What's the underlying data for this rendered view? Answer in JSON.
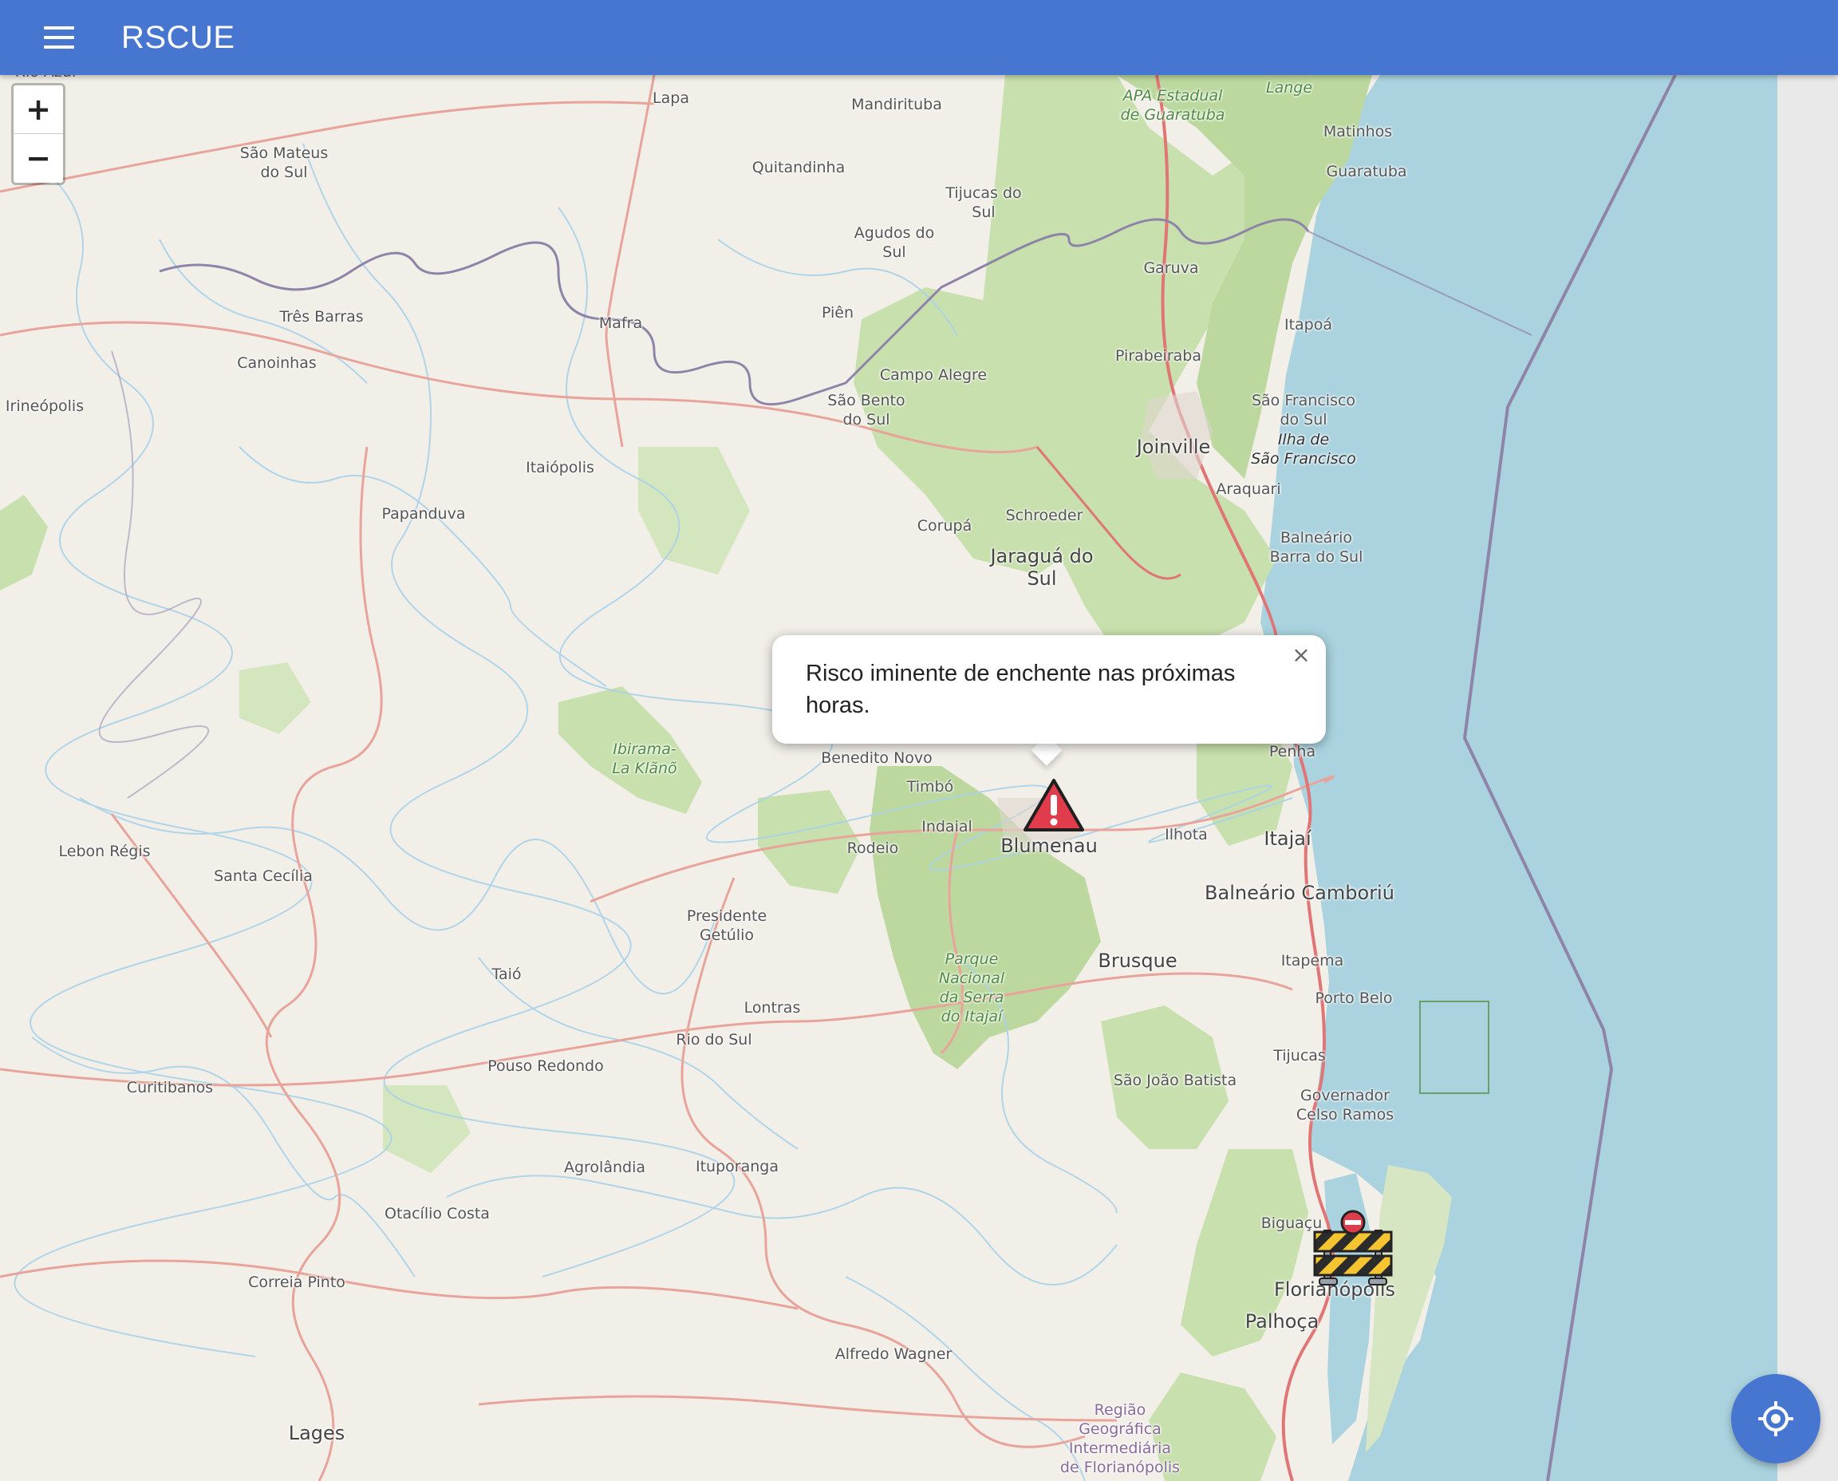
{
  "app": {
    "title": "RSCUE"
  },
  "toolbar": {
    "menu_icon": "hamburger-menu-icon"
  },
  "zoom": {
    "in_label": "+",
    "out_label": "−"
  },
  "popup": {
    "text": "Risco iminente de enchente nas próximas horas.",
    "close_label": "×"
  },
  "markers": [
    {
      "type": "flood-warning",
      "icon": "warning-triangle-icon",
      "color": "#e03c4c",
      "location": "Blumenau"
    },
    {
      "type": "road-block",
      "icon": "road-barrier-icon",
      "location": "Florianópolis"
    }
  ],
  "fab": {
    "icon": "my-location-icon"
  },
  "colors": {
    "appbar": "#4776d0",
    "sea": "#aad3df",
    "land": "#f2efe9",
    "forest": "#c8e0ad",
    "road": "#e8a49a",
    "river": "#a9d2e8"
  },
  "map": {
    "places": [
      {
        "name": "Lapa"
      },
      {
        "name": "Mandirituba"
      },
      {
        "name": "São Mateus\ndo Sul"
      },
      {
        "name": "Quitandinha"
      },
      {
        "name": "Tijucas do\nSul"
      },
      {
        "name": "Agudos do\nSul"
      },
      {
        "name": "APA Estadual\nde Guaratuba"
      },
      {
        "name": "Matinhos"
      },
      {
        "name": "Guaratuba"
      },
      {
        "name": "Garuva"
      },
      {
        "name": "Três Barras"
      },
      {
        "name": "Mafra"
      },
      {
        "name": "Piên"
      },
      {
        "name": "Itapoá"
      },
      {
        "name": "Canoinhas"
      },
      {
        "name": "Campo Alegre"
      },
      {
        "name": "Pirabeiraba"
      },
      {
        "name": "Irineópolis"
      },
      {
        "name": "São Bento\ndo Sul"
      },
      {
        "name": "São Francisco\ndo Sul"
      },
      {
        "name": "Ilha de\nSão Francisco"
      },
      {
        "name": "Joinville"
      },
      {
        "name": "Itaiópolis"
      },
      {
        "name": "Araquari"
      },
      {
        "name": "Papanduva"
      },
      {
        "name": "Schroeder"
      },
      {
        "name": "Corupá"
      },
      {
        "name": "Balneário\nBarra do Sul"
      },
      {
        "name": "Jaraguá do\nSul"
      },
      {
        "name": "Ibirama-\nLa Klãnõ"
      },
      {
        "name": "Benedito Novo"
      },
      {
        "name": "Penha"
      },
      {
        "name": "Timbó"
      },
      {
        "name": "Indaial"
      },
      {
        "name": "Ilhota"
      },
      {
        "name": "Itajaí"
      },
      {
        "name": "Rodeio"
      },
      {
        "name": "Blumenau"
      },
      {
        "name": "Lebon Régis"
      },
      {
        "name": "Santa Cecília"
      },
      {
        "name": "Balneário Camboriú"
      },
      {
        "name": "Presidente\nGetúlio"
      },
      {
        "name": "Parque\nNacional\nda Serra\ndo Itajaí"
      },
      {
        "name": "Brusque"
      },
      {
        "name": "Itapema"
      },
      {
        "name": "Taió"
      },
      {
        "name": "Porto Belo"
      },
      {
        "name": "Lontras"
      },
      {
        "name": "Rio do Sul"
      },
      {
        "name": "Tijucas"
      },
      {
        "name": "Pouso Redondo"
      },
      {
        "name": "São João Batista"
      },
      {
        "name": "Curitibanos"
      },
      {
        "name": "Governador\nCelso Ramos"
      },
      {
        "name": "Agrolândia"
      },
      {
        "name": "Ituporanga"
      },
      {
        "name": "Otacílio Costa"
      },
      {
        "name": "Biguaçu"
      },
      {
        "name": "Florianópolis"
      },
      {
        "name": "Correia Pinto"
      },
      {
        "name": "Palhoça"
      },
      {
        "name": "Alfredo Wagner"
      },
      {
        "name": "Região\nGeográfica\nIntermediária\nde Florianópolis"
      },
      {
        "name": "Lages"
      },
      {
        "name": "Rio Azul"
      },
      {
        "name": "Hilairé\nLange"
      }
    ]
  }
}
